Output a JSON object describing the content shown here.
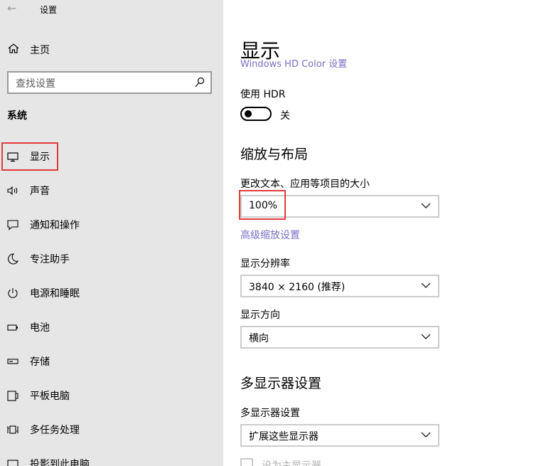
{
  "window": {
    "title": "设置"
  },
  "sidebar": {
    "home_label": "主页",
    "search_placeholder": "查找设置",
    "section_title": "系统",
    "items": [
      {
        "label": "显示",
        "icon": "monitor-icon"
      },
      {
        "label": "声音",
        "icon": "speaker-icon"
      },
      {
        "label": "通知和操作",
        "icon": "notification-icon"
      },
      {
        "label": "专注助手",
        "icon": "moon-icon"
      },
      {
        "label": "电源和睡眠",
        "icon": "power-icon"
      },
      {
        "label": "电池",
        "icon": "battery-icon"
      },
      {
        "label": "存储",
        "icon": "storage-icon"
      },
      {
        "label": "平板电脑",
        "icon": "tablet-icon"
      },
      {
        "label": "多任务处理",
        "icon": "multitask-icon"
      },
      {
        "label": "投影到此电脑",
        "icon": "project-icon"
      }
    ]
  },
  "main": {
    "page_title": "显示",
    "clipped_link": "Windows HD Color 设置",
    "hdr_label": "使用 HDR",
    "hdr_state": "关",
    "scale_section_title": "缩放与布局",
    "scale_label": "更改文本、应用等项目的大小",
    "scale_value": "100%",
    "advanced_scaling_link": "高级缩放设置",
    "resolution_label": "显示分辨率",
    "resolution_value": "3840 × 2160 (推荐)",
    "orientation_label": "显示方向",
    "orientation_value": "横向",
    "multi_section_title": "多显示器设置",
    "multi_label": "多显示器设置",
    "multi_value": "扩展这些显示器",
    "main_display_checkbox": "设为主显示器"
  },
  "colors": {
    "sidebar_bg": "#e6e6e6",
    "link": "#7a6fc6",
    "highlight": "#e23b3b"
  }
}
